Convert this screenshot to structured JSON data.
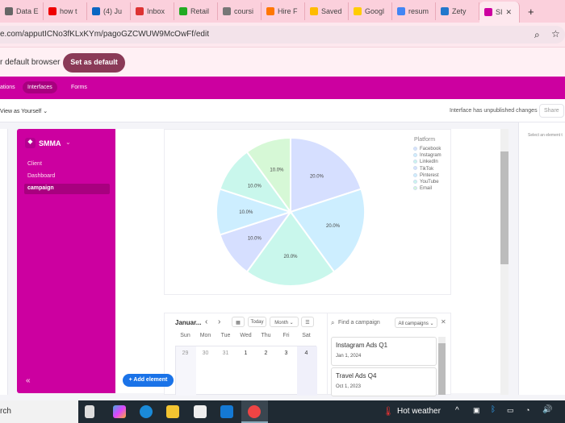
{
  "browser": {
    "tabs": [
      {
        "label": "Data E",
        "color": "#666"
      },
      {
        "label": "how t",
        "color": "#e00"
      },
      {
        "label": "(4) Ju",
        "color": "#0a66c2"
      },
      {
        "label": "Inbox",
        "color": "#d33"
      },
      {
        "label": "Retail",
        "color": "#2a2"
      },
      {
        "label": "coursi",
        "color": "#777"
      },
      {
        "label": "Hire F",
        "color": "#f70"
      },
      {
        "label": "Saved",
        "color": "#fb0"
      },
      {
        "label": "Googl",
        "color": "#fc0"
      },
      {
        "label": "resum",
        "color": "#4285f4"
      },
      {
        "label": "Zety",
        "color": "#27c"
      },
      {
        "label": "SI",
        "color": "#cc00a0",
        "favicon_text": "Sm"
      }
    ],
    "new_tab": "+",
    "close": "✕",
    "url": "e.com/apputICNo3fKLxKYm/pagoGZCWUW9McOwFf/edit",
    "zoom_icon": "⌕",
    "star_icon": "☆"
  },
  "banner": {
    "text": "r default browser",
    "button": "Set as default"
  },
  "nav": {
    "items": [
      "ations",
      "Interfaces",
      "Forms"
    ]
  },
  "subheader": {
    "view_as": "View as Yourself",
    "status": "Interface has unpublished changes",
    "share": "Share"
  },
  "sidebar": {
    "app_name": "SMMA",
    "items": [
      "Client",
      "Dashboard",
      "campaign"
    ],
    "collapse": "«"
  },
  "add_element": "+ Add element",
  "right_panel": {
    "hint": "Select an element t"
  },
  "chart_data": {
    "type": "pie",
    "legend_title": "Platform",
    "legend_position": "top-right",
    "categories": [
      "Facebook",
      "Instagram",
      "LinkedIn",
      "TikTok",
      "Pinterest",
      "YouTube",
      "Email"
    ],
    "values": [
      20,
      20,
      20,
      10,
      10,
      10,
      10
    ],
    "labels": [
      "20.0%",
      "20.0%",
      "20.0%",
      "10.0%",
      "10.0%",
      "10.0%",
      "10.0%"
    ],
    "colors": [
      "#d6dfff",
      "#cdeeff",
      "#c9f7ec",
      "#d6dfff",
      "#cdeeff",
      "#c9f7ec",
      "#d6f8d6"
    ]
  },
  "calendar": {
    "title": "Januar...",
    "prev": "‹",
    "next": "›",
    "today": "Today",
    "view": "Month",
    "days": [
      "Sun",
      "Mon",
      "Tue",
      "Wed",
      "Thu",
      "Fri",
      "Sat"
    ],
    "dates": [
      "29",
      "30",
      "31",
      "1",
      "2",
      "3",
      "4"
    ]
  },
  "campaigns": {
    "search_placeholder": "Find a campaign",
    "filter": "All campaigns",
    "close": "✕",
    "items": [
      {
        "name": "Instagram Ads Q1",
        "date": "Jan 1, 2024"
      },
      {
        "name": "Travel Ads Q4",
        "date": "Oct 1, 2023"
      }
    ]
  },
  "taskbar": {
    "search": "rch",
    "weather": "Hot weather"
  }
}
